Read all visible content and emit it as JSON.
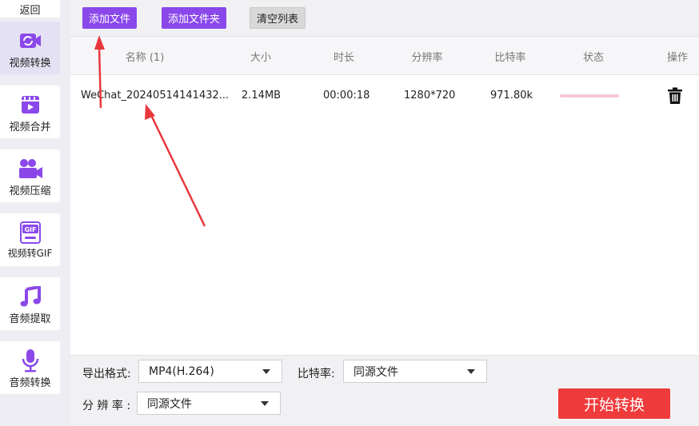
{
  "sidebar": {
    "back_label": "返回",
    "items": [
      {
        "label": "视频转换",
        "icon": "video-convert-icon",
        "active": true
      },
      {
        "label": "视频合并",
        "icon": "video-merge-icon"
      },
      {
        "label": "视频压缩",
        "icon": "video-compress-icon"
      },
      {
        "label": "视频转GIF",
        "icon": "gif-icon"
      },
      {
        "label": "音频提取",
        "icon": "music-note-icon"
      },
      {
        "label": "音频转换",
        "icon": "microphone-icon"
      }
    ]
  },
  "toolbar": {
    "add_file": "添加文件",
    "add_folder": "添加文件夹",
    "clear_list": "清空列表"
  },
  "table": {
    "headers": [
      "名称 (1)",
      "大小",
      "时长",
      "分辨率",
      "比特率",
      "状态",
      "操作"
    ],
    "rows": [
      {
        "name": "WeChat_20240514141432...",
        "size": "2.14MB",
        "duration": "00:00:18",
        "resolution": "1280*720",
        "bitrate": "971.80k",
        "status_icon": "progress-bar",
        "action_icon": "trash-icon"
      }
    ]
  },
  "settings": {
    "format_label": "导出格式:",
    "format_value": "MP4(H.264)",
    "bitrate_label": "比特率:",
    "bitrate_value": "同源文件",
    "resolution_label": "分 辨 率 :",
    "resolution_value": "同源文件",
    "start_label": "开始转换"
  },
  "colors": {
    "accent": "#8a48ea",
    "start": "#ef3b3b",
    "arrow": "#e8383c",
    "active_nav": "#e4e1f4"
  }
}
